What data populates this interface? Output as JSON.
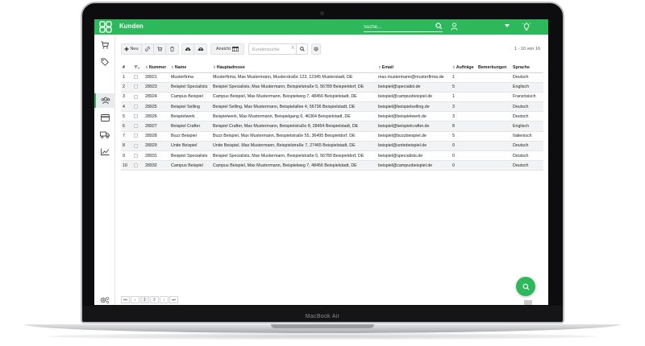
{
  "device": {
    "label": "MacBook Air"
  },
  "app": {
    "title": "Kunden",
    "search_placeholder": "Suche..."
  },
  "toolbar": {
    "new_label": "Neu",
    "view_label": "Ansicht",
    "search_placeholder": "Kundensuche",
    "clear_glyph": "X",
    "count_text": "1 - 10 von 16"
  },
  "table": {
    "headers": [
      "#",
      "",
      "Nummer",
      "Name",
      "Hauptadresse",
      "Email",
      "Aufträge",
      "Bemerkungen",
      "Sprache"
    ],
    "rows": [
      [
        "1",
        "28921",
        "Musterfirma",
        "Musterfirma, Max Mustermann, Musterstraße 123, 12345 Musterstadt, DE",
        "max.mustermann@musterfirma.de",
        "1",
        "",
        "Deutsch"
      ],
      [
        "2",
        "28923",
        "Beispiel Specialists",
        "Beispiel Specialists, Max Mustermann, Beispielstraße 5, 56789 Beispieldorf, DE",
        "beispiel@specialist.de",
        "5",
        "",
        "Englisch"
      ],
      [
        "3",
        "28924",
        "Campus Beispiel",
        "Campus Beispiel, Max Mustermann, Beispielweg 7, 48456 Beispielstadt, DE",
        "beispiel@campusbeispiel.de",
        "1",
        "",
        "Französisch"
      ],
      [
        "4",
        "28925",
        "Beispiel Selling",
        "Beispiel Selling, Max Mustermann, Beispielallee 4, 56736 Beispielstadt, DE",
        "beispiel@beispielselling.de",
        "3",
        "",
        "Deutsch"
      ],
      [
        "5",
        "28926",
        "Beispielwerk",
        "Beispielwerk, Max Mustermann, Beispielgang 6, 46364 Beispielstadt, DE",
        "beispiel@beispielwerk.de",
        "3",
        "",
        "Deutsch"
      ],
      [
        "6",
        "28927",
        "Beispiel Crafter",
        "Beispiel Crafter, Max Mustermann, Beispielstraße 8, 28454 Beispielstadt, DE",
        "beispiel@beispielcrafter.de",
        "8",
        "",
        "Englisch"
      ],
      [
        "7",
        "28928",
        "Buzz Beispiel",
        "Buzz Beispiel, Max Mustermann, Beispielstraße 55, 36495 Beispieldorf, DE",
        "beispiel@buzzbeispiel.de",
        "5",
        "",
        "Italienisch"
      ],
      [
        "8",
        "28929",
        "Unite Beispiel",
        "Unite Beispiel, Max Mustermann, Beispielstraße 7, 27465 Beispielstadt, DE",
        "beispiel@unitebeispiel.de",
        "0",
        "",
        "Deutsch"
      ],
      [
        "9",
        "28931",
        "Beispiel Specialists",
        "Beispiel Specialists, Max Mustermann, Beispielstraße 5, 56789 Beispieldorf, DE",
        "beispiel@specialists.de",
        "0",
        "",
        "Deutsch"
      ],
      [
        "10",
        "28932",
        "Campus Beispiel",
        "Campus Beispiel, Max Mustermann, Beispielweg 7, 48456 Beispielstadt, DE",
        "beispiel@campusbeispiel.de",
        "0",
        "",
        "Deutsch"
      ]
    ]
  },
  "pager": {
    "pages": [
      "1",
      "2"
    ],
    "current": "1"
  },
  "colors": {
    "accent": "#2db85c",
    "row_alt": "#f2f3f4"
  },
  "icons": {
    "sidebar": [
      "cart-icon",
      "tag-icon",
      "users-icon",
      "card-icon",
      "truck-icon",
      "chart-icon",
      "settings-icon",
      "expand-icon"
    ],
    "topbar": [
      "logo-icon",
      "search-icon",
      "user-icon",
      "chevron-down-icon",
      "bulb-icon"
    ],
    "toolbar": [
      "plus-icon",
      "link-icon",
      "cart-icon",
      "trash-icon",
      "cloud-download-icon",
      "cloud-upload-icon",
      "columns-icon",
      "search-icon",
      "gear-icon"
    ]
  }
}
